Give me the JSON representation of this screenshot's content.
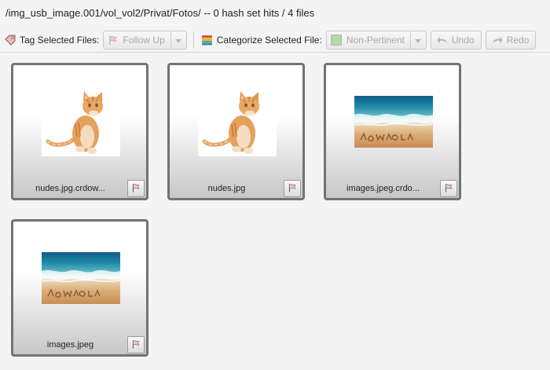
{
  "header": {
    "path": "/img_usb_image.001/vol_vol2/Privat/Fotos/",
    "summary": "-- 0 hash set hits / 4 files"
  },
  "toolbar": {
    "tag_label": "Tag Selected Files:",
    "tag_value": "Follow Up",
    "categorize_label": "Categorize Selected File:",
    "category_value": "Non-Pertinent",
    "undo_label": "Undo",
    "redo_label": "Redo"
  },
  "files": [
    {
      "name": "nudes.jpg.crdow...",
      "thumbnail": "cat"
    },
    {
      "name": "nudes.jpg",
      "thumbnail": "cat"
    },
    {
      "name": "images.jpeg.crdo...",
      "thumbnail": "beach"
    },
    {
      "name": "images.jpeg",
      "thumbnail": "beach"
    }
  ],
  "colors": {
    "tile_border": "#737373",
    "disabled_text": "#a9a9a9",
    "category_swatch": "#b9d3b4",
    "tag_icon": "#e8a0a8"
  }
}
